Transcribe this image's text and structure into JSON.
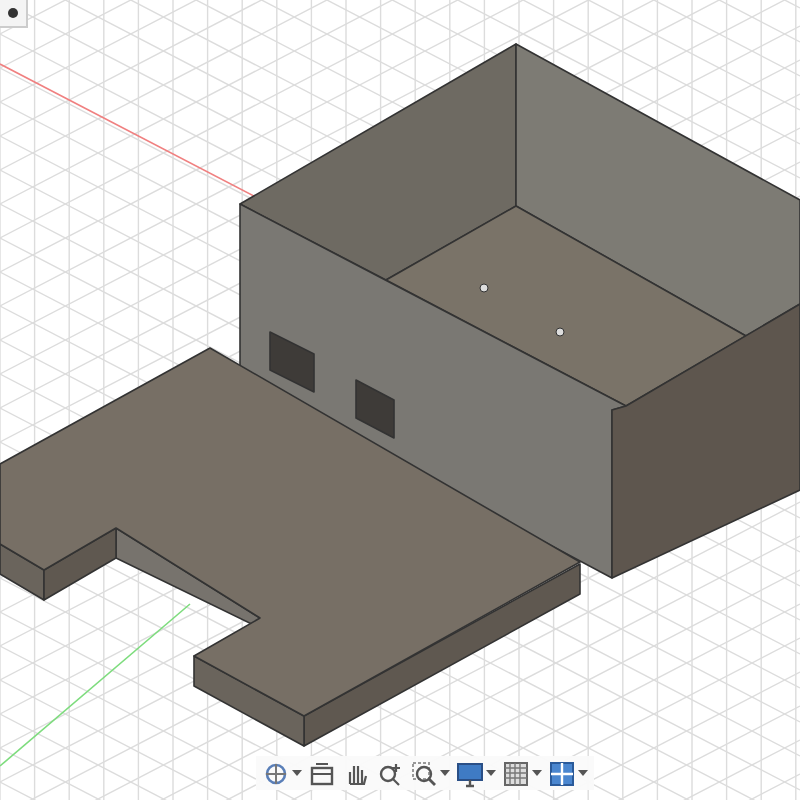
{
  "toolbar": [
    {
      "kind": "orbit",
      "dropdown": true
    },
    {
      "kind": "look_at",
      "dropdown": false
    },
    {
      "kind": "pan",
      "dropdown": false
    },
    {
      "kind": "zoom",
      "dropdown": false
    },
    {
      "kind": "fit",
      "dropdown": true
    },
    {
      "kind": "display",
      "dropdown": true
    },
    {
      "kind": "grid",
      "dropdown": true
    },
    {
      "kind": "viewports",
      "dropdown": true
    }
  ]
}
